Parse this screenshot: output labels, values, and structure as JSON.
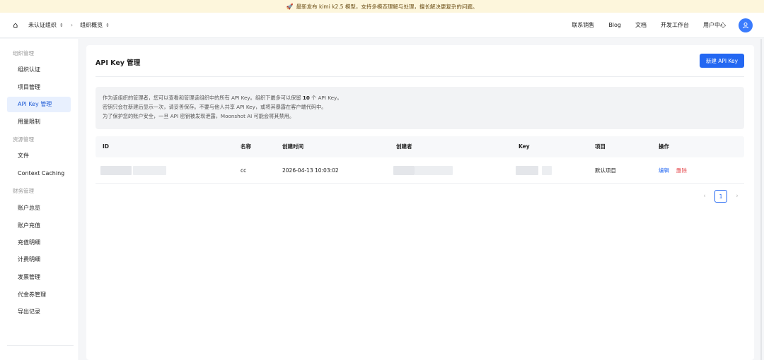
{
  "banner": {
    "icon": "rocket-icon",
    "text": "最新发布 kimi k2.5 模型，支持多模态理解与处理，擅长解决更复杂的问题。"
  },
  "topbar": {
    "org": "未认证组织",
    "page": "组织概览",
    "nav": [
      "联系销售",
      "Blog",
      "文档",
      "开发工作台",
      "用户中心"
    ],
    "avatar_icon": "user-icon"
  },
  "sidebar": {
    "sections": [
      {
        "title": "组织管理",
        "items": [
          "组织认证",
          "项目管理",
          "API Key 管理",
          "用量限制"
        ]
      },
      {
        "title": "资源管理",
        "items": [
          "文件",
          "Context Caching"
        ]
      },
      {
        "title": "财务管理",
        "items": [
          "账户总览",
          "账户充值",
          "充值明细",
          "计费明细",
          "发票管理",
          "代金券管理",
          "导出记录"
        ]
      }
    ],
    "active": "API Key 管理"
  },
  "main": {
    "title": "API Key 管理",
    "new_button": "新建 API Key",
    "notice": {
      "line1_pre": "作为该组织的管理者，您可以查看和管理该组织中的所有 API Key。组织下最多可以保留",
      "line1_num": "10",
      "line1_post": "个 API Key。",
      "line2": "密钥只会在新建后显示一次，请妥善保存。不要与他人共享 API Key，或将其暴露在客户端代码中。",
      "line3": "为了保护您的账户安全，一旦 API 密钥被发现泄露，Moonshot AI 可能会将其禁用。"
    },
    "table": {
      "headers": [
        "ID",
        "名称",
        "创建时间",
        "创建者",
        "Key",
        "项目",
        "操作"
      ],
      "rows": [
        {
          "name": "cc",
          "created": "2026-04-13 10:03:02",
          "project": "默认项目",
          "edit": "编辑",
          "delete": "删除"
        }
      ]
    },
    "pagination": {
      "current": "1"
    }
  },
  "colors": {
    "primary": "#2468f2",
    "danger": "#e5484d",
    "banner_bg": "#fdf6dc",
    "active_bg": "#e8f0fe"
  }
}
